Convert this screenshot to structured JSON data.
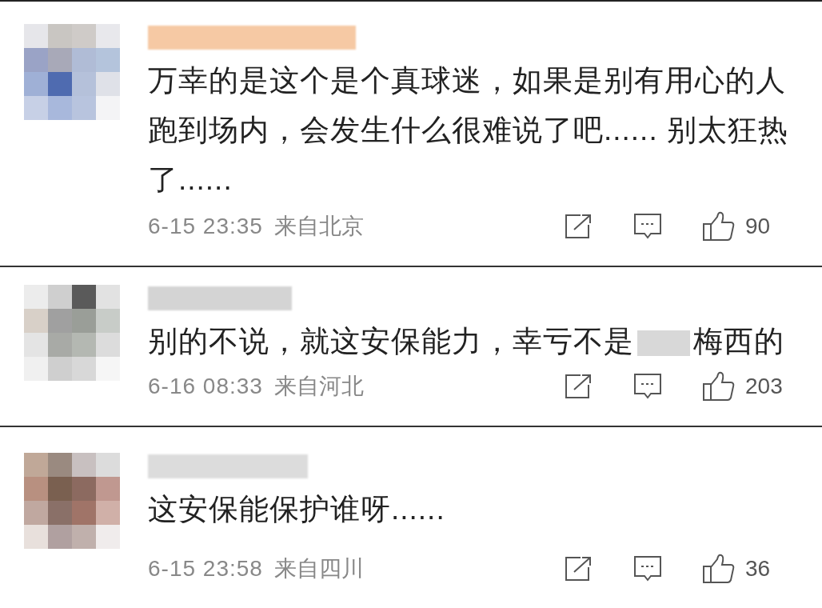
{
  "comments": [
    {
      "segments": [
        {
          "kind": "text",
          "text": "万幸的是这个是个真球迷，如果是别有用心的人跑到场内，会发生什么很难说了吧...... 别太狂热了......"
        }
      ],
      "time": "6-15 23:35",
      "location": "来自北京",
      "likes": "90"
    },
    {
      "segments": [
        {
          "kind": "text",
          "text": "别的不说，就这安保能力，幸亏不是"
        },
        {
          "kind": "redacted"
        },
        {
          "kind": "text",
          "text": "梅西的"
        }
      ],
      "time": "6-16 08:33",
      "location": "来自河北",
      "likes": "203"
    },
    {
      "segments": [
        {
          "kind": "text",
          "text": "这安保能保护谁呀......"
        }
      ],
      "time": "6-15 23:58",
      "location": "来自四川",
      "likes": "36"
    }
  ]
}
